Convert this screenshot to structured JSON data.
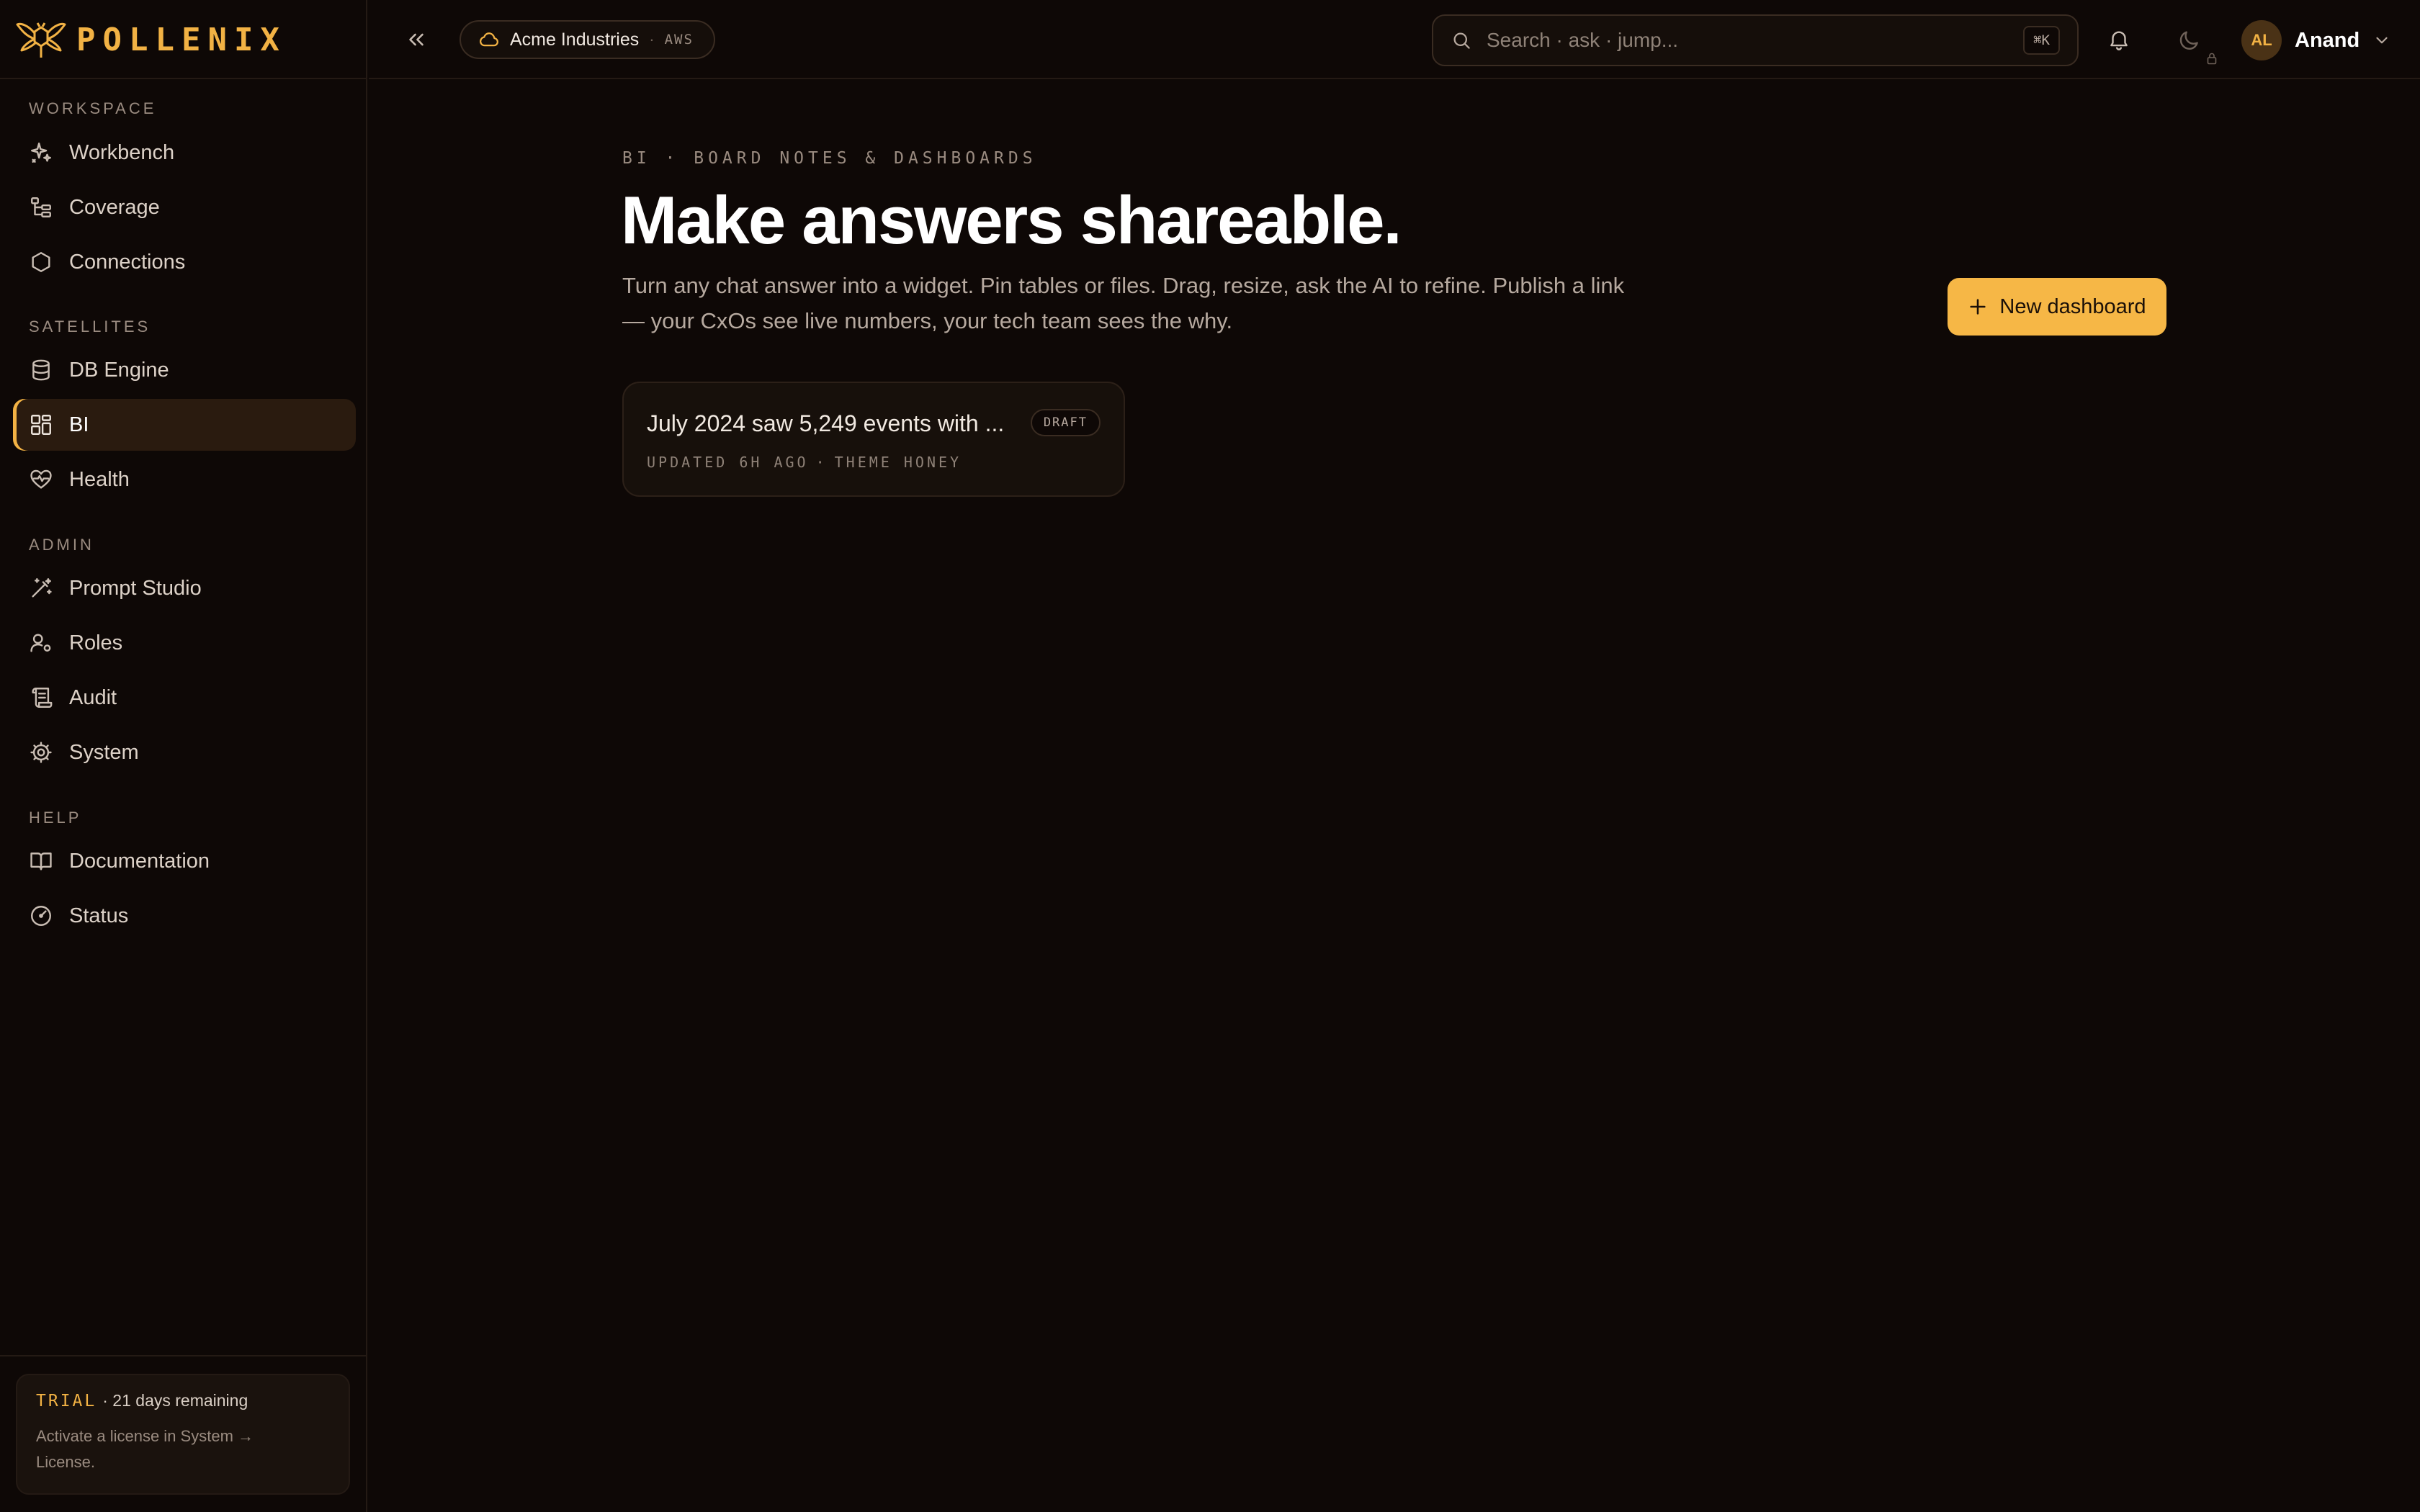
{
  "brand": {
    "name": "POLLENIX",
    "accent": "#f2b244"
  },
  "sidebar": {
    "sections": [
      {
        "label": "WORKSPACE",
        "items": [
          {
            "label": "Workbench",
            "icon": "sparkles-icon"
          },
          {
            "label": "Coverage",
            "icon": "tree-icon"
          },
          {
            "label": "Connections",
            "icon": "hexagon-icon"
          }
        ]
      },
      {
        "label": "SATELLITES",
        "items": [
          {
            "label": "DB Engine",
            "icon": "database-icon"
          },
          {
            "label": "BI",
            "icon": "dashboard-grid-icon",
            "active": true
          },
          {
            "label": "Health",
            "icon": "heart-pulse-icon"
          }
        ]
      },
      {
        "label": "ADMIN",
        "items": [
          {
            "label": "Prompt Studio",
            "icon": "magic-wand-icon"
          },
          {
            "label": "Roles",
            "icon": "user-gear-icon"
          },
          {
            "label": "Audit",
            "icon": "scroll-icon"
          },
          {
            "label": "System",
            "icon": "gear-icon"
          }
        ]
      },
      {
        "label": "HELP",
        "items": [
          {
            "label": "Documentation",
            "icon": "book-icon"
          },
          {
            "label": "Status",
            "icon": "gauge-icon"
          }
        ]
      }
    ],
    "trial": {
      "tag": "TRIAL",
      "remaining": "· 21 days remaining",
      "note": "Activate a license in System → License."
    }
  },
  "topbar": {
    "tenant": {
      "name": "Acme Industries",
      "separator": "·",
      "cloud": "AWS"
    },
    "search": {
      "placeholder": "Search · ask · jump...",
      "shortcut": "⌘K"
    },
    "user": {
      "initials": "AL",
      "name": "Anand"
    }
  },
  "main": {
    "eyebrow": "BI · BOARD NOTES & DASHBOARDS",
    "title": "Make answers shareable.",
    "description": "Turn any chat answer into a widget. Pin tables or files. Drag, resize, ask the AI to refine. Publish a link — your CxOs see live numbers, your tech team sees the why.",
    "new_button_label": "New dashboard",
    "dashboards": [
      {
        "title": "July 2024 saw 5,249 events with ...",
        "badge": "DRAFT",
        "updated": "UPDATED 6H AGO",
        "sep": "·",
        "theme": "THEME HONEY"
      }
    ]
  }
}
